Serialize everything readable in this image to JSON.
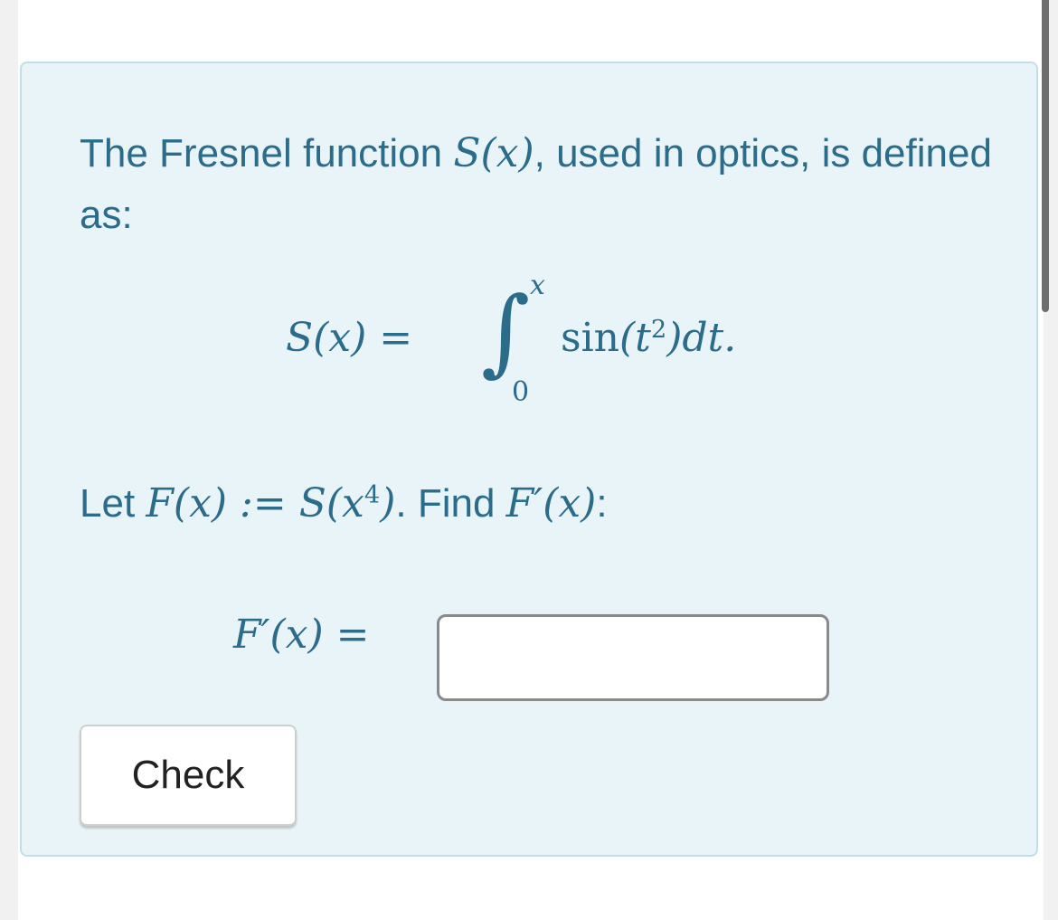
{
  "question": {
    "intro_prefix": "The Fresnel function ",
    "intro_math": "S(x)",
    "intro_suffix": ", used in optics, is defined as:",
    "display_lhs": "S(x) =",
    "integral_sign": "∫",
    "integral_upper": "x",
    "integral_lower": "0",
    "integrand_fn": "sin",
    "integrand_arg_open": "(t",
    "integrand_exp": "2",
    "integrand_tail": ")dt.",
    "let_prefix": "Let ",
    "let_math_lhs": "F(x) := S(x",
    "let_math_exp": "4",
    "let_math_rhs": ")",
    "find_text": ". Find ",
    "find_math": "F′(x)",
    "find_colon": ":"
  },
  "answer": {
    "label": "F′(x) =",
    "input_value": "",
    "input_placeholder": ""
  },
  "actions": {
    "check_label": "Check"
  },
  "colors": {
    "text_accent": "#2a6c8a",
    "card_background": "#e8f4f7",
    "card_border": "#c1dfe7"
  }
}
